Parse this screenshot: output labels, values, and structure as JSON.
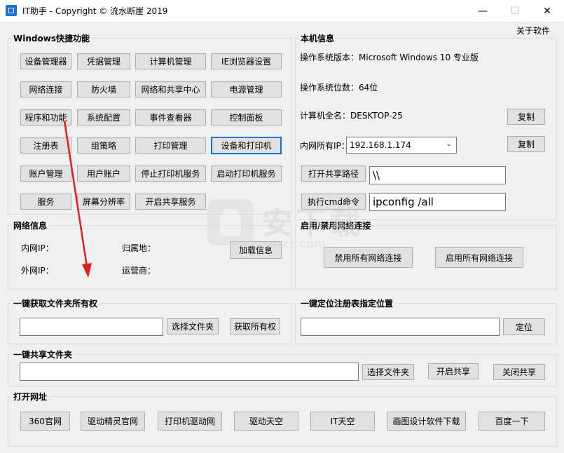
{
  "window": {
    "title": "IT助手 - Copyright © 流水断崖 2019",
    "about_label": "关于软件"
  },
  "shortcuts": {
    "legend": "Windows快捷功能",
    "buttons": [
      "设备管理器",
      "凭据管理",
      "计算机管理",
      "IE浏览器设置",
      "网络连接",
      "防火墙",
      "网络和共享中心",
      "电源管理",
      "程序和功能",
      "系统配置",
      "事件查看器",
      "控制面板",
      "注册表",
      "组策略",
      "打印管理",
      "设备和打印机",
      "账户管理",
      "用户账户",
      "停止打印机服务",
      "启动打印机服务",
      "服务",
      "屏幕分辨率",
      "开启共享服务"
    ]
  },
  "sysinfo": {
    "legend": "本机信息",
    "os_version": "操作系统版本：Microsoft Windows 10 专业版",
    "os_bits": "操作系统位数：64位",
    "computer_name": "计算机全名：DESKTOP-25",
    "copy_label": "复制",
    "ip_label": "内网所有IP：",
    "ip_value": "192.168.1.174",
    "share_path_button": "打开共享路径",
    "share_path_value": "\\\\",
    "cmd_button": "执行cmd命令",
    "cmd_value": "ipconfig /all"
  },
  "netinfo": {
    "legend": "网络信息",
    "lan_ip_label": "内网IP：",
    "wan_ip_label": "外网IP：",
    "location_label": "归属地：",
    "isp_label": "运营商：",
    "load_button": "加载信息"
  },
  "netconn": {
    "legend": "启用/禁用网络连接",
    "disable_all": "禁用所有网络连接",
    "enable_all": "启用所有网络连接"
  },
  "ownership": {
    "legend": "一键获取文件夹所有权",
    "path_value": "",
    "select_folder": "选择文件夹",
    "take_ownership": "获取所有权"
  },
  "regjump": {
    "legend": "一键定位注册表指定位置",
    "path_value": "",
    "locate": "定位"
  },
  "share": {
    "legend": "一键共享文件夹",
    "path_value": "",
    "select_folder": "选择文件夹",
    "open_share": "开启共享",
    "close_share": "关闭共享"
  },
  "urls": {
    "legend": "打开网址",
    "buttons": [
      "360官网",
      "驱动精灵官网",
      "打印机驱动网",
      "驱动天空",
      "IT天空",
      "画图设计软件下载",
      "百度一下"
    ]
  },
  "watermark": {
    "text_cn": "安下载",
    "text_url": "anxz.com"
  },
  "colors": {
    "accent_focus": "#0078d7",
    "annotation_arrow": "#e02020",
    "button_bg": "#e1e1e1"
  }
}
